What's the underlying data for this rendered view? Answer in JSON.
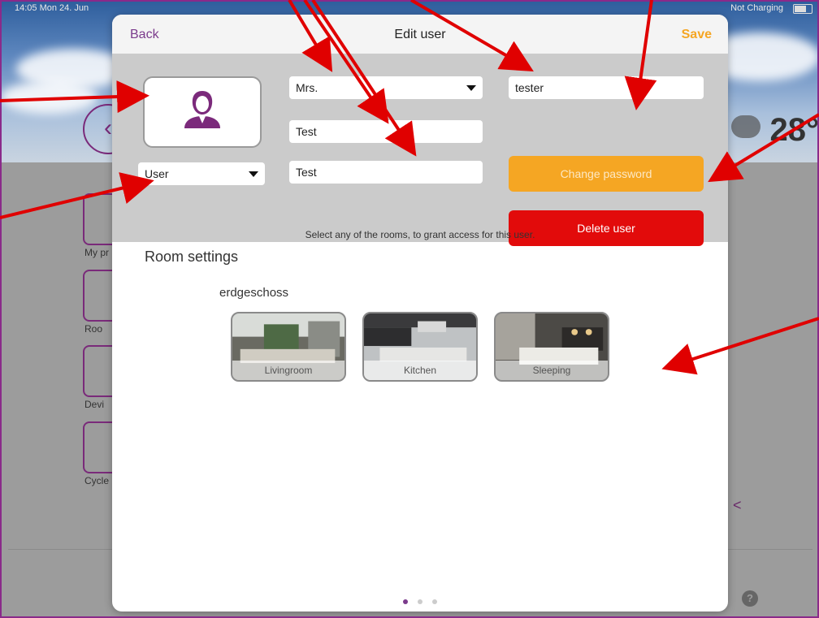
{
  "status_bar": {
    "time": "14:05 Mon 24. Jun",
    "charging": "Not Charging"
  },
  "background": {
    "temperature": "28°",
    "tiles": [
      "My pr",
      "Roo",
      "Devi",
      "Cycle"
    ],
    "help_label": "?"
  },
  "nav": {
    "back_label": "Back",
    "title": "Edit user",
    "save_label": "Save"
  },
  "form": {
    "role_select": "User",
    "salutation_select": "Mrs.",
    "first_name": "Test",
    "last_name": "Test",
    "username": "tester",
    "change_password_label": "Change password",
    "delete_user_label": "Delete user"
  },
  "hint_text": "Select any of the rooms, to grant access for this user.",
  "room_settings": {
    "heading": "Room settings",
    "floor": "erdgeschoss",
    "rooms": [
      "Livingroom",
      "Kitchen",
      "Sleeping"
    ]
  },
  "pager": {
    "pages": 3,
    "active": 1
  },
  "colors": {
    "accent": "#7b3b8c",
    "save": "#f5a623",
    "danger": "#e20b0b",
    "annotation": "#e00000"
  }
}
